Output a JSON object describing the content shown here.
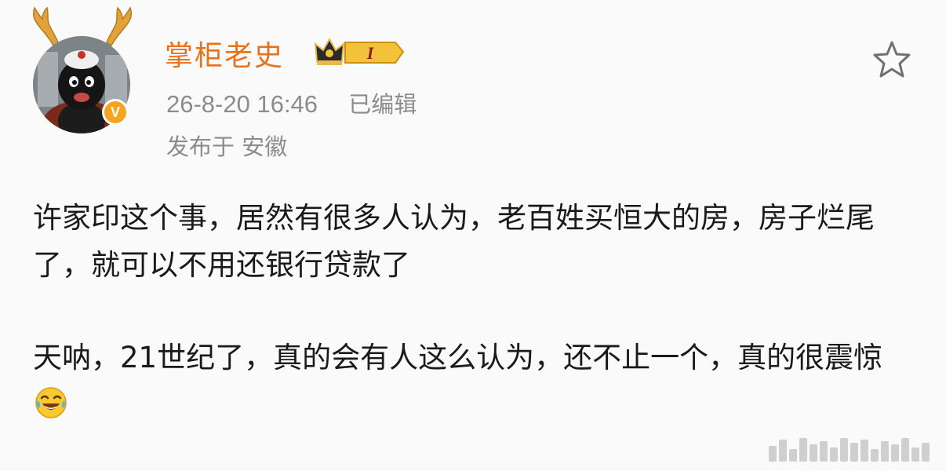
{
  "post": {
    "author": {
      "name": "掌柜老史",
      "verified_badge": "V",
      "level": "I",
      "avatar_icon": "deer-antler-avatar"
    },
    "meta": {
      "timestamp": "26-8-20 16:46",
      "edited_label": "已编辑",
      "location": "发布于 安徽"
    },
    "actions": {
      "favorite_icon": "star-outline-icon"
    },
    "content": {
      "paragraph_1": "许家印这个事，居然有很多人认为，老百姓买恒大的房，房子烂尾了，就可以不用还银行贷款了",
      "paragraph_2": "天呐，21世纪了，真的会有人这么认为，还不止一个，真的很震惊",
      "emoji": "laughing-crying-emoji"
    }
  },
  "colors": {
    "username": "#e8711b",
    "meta_text": "#8c8c8c",
    "body_text": "#1a1a1a",
    "verified": "#f7a320",
    "background": "#fafafa"
  }
}
